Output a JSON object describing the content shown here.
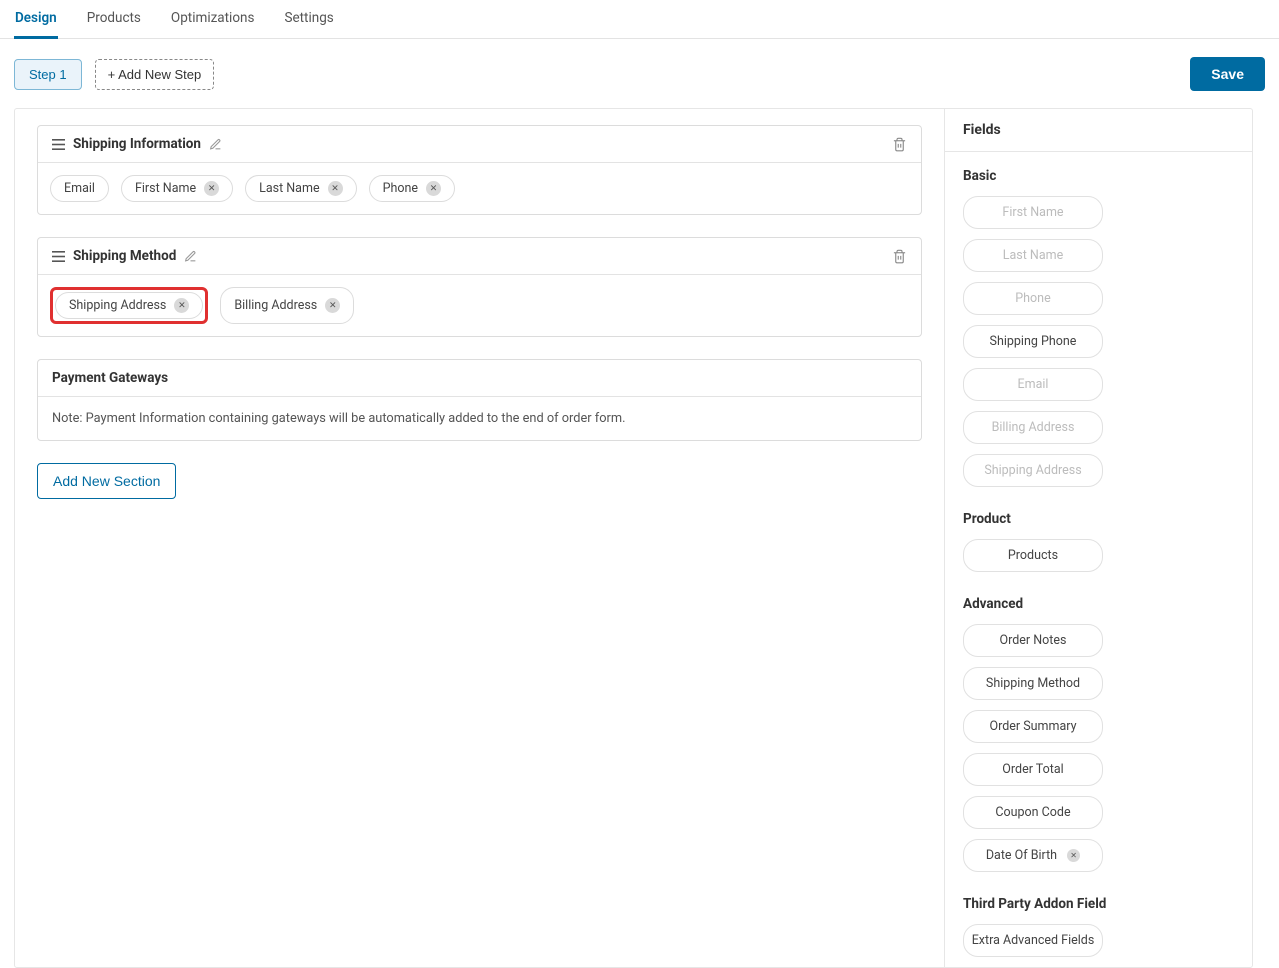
{
  "tabs": [
    "Design",
    "Products",
    "Optimizations",
    "Settings"
  ],
  "activeTab": 0,
  "toolbar": {
    "step_label": "Step 1",
    "add_step_label": "+ Add New Step",
    "save_label": "Save"
  },
  "sections": [
    {
      "title": "Shipping Information",
      "fields": [
        {
          "label": "Email",
          "removable": false
        },
        {
          "label": "First Name",
          "removable": true
        },
        {
          "label": "Last Name",
          "removable": true
        },
        {
          "label": "Phone",
          "removable": true
        }
      ]
    },
    {
      "title": "Shipping Method",
      "fields": [
        {
          "label": "Shipping Address",
          "removable": true,
          "highlighted": true
        },
        {
          "label": "Billing Address",
          "removable": true
        }
      ]
    }
  ],
  "payment_gateways": {
    "title": "Payment Gateways",
    "note": "Note: Payment Information containing gateways will be automatically added to the end of order form."
  },
  "add_section_label": "Add New Section",
  "panel": {
    "title": "Fields",
    "groups": [
      {
        "title": "Basic",
        "items": [
          {
            "label": "First Name",
            "disabled": true
          },
          {
            "label": "Last Name",
            "disabled": true
          },
          {
            "label": "Phone",
            "disabled": true
          },
          {
            "label": "Shipping Phone",
            "disabled": false
          },
          {
            "label": "Email",
            "disabled": true
          },
          {
            "label": "Billing Address",
            "disabled": true
          },
          {
            "label": "Shipping Address",
            "disabled": true
          }
        ]
      },
      {
        "title": "Product",
        "items": [
          {
            "label": "Products",
            "disabled": false
          }
        ]
      },
      {
        "title": "Advanced",
        "items": [
          {
            "label": "Order Notes",
            "disabled": false
          },
          {
            "label": "Shipping Method",
            "disabled": false
          },
          {
            "label": "Order Summary",
            "disabled": false
          },
          {
            "label": "Order Total",
            "disabled": false
          },
          {
            "label": "Coupon Code",
            "disabled": false
          },
          {
            "label": "Date Of Birth",
            "disabled": false,
            "removable": true
          }
        ]
      },
      {
        "title": "Third Party Addon Field",
        "items": [
          {
            "label": "Extra Advanced Fields",
            "disabled": false
          }
        ]
      }
    ]
  }
}
